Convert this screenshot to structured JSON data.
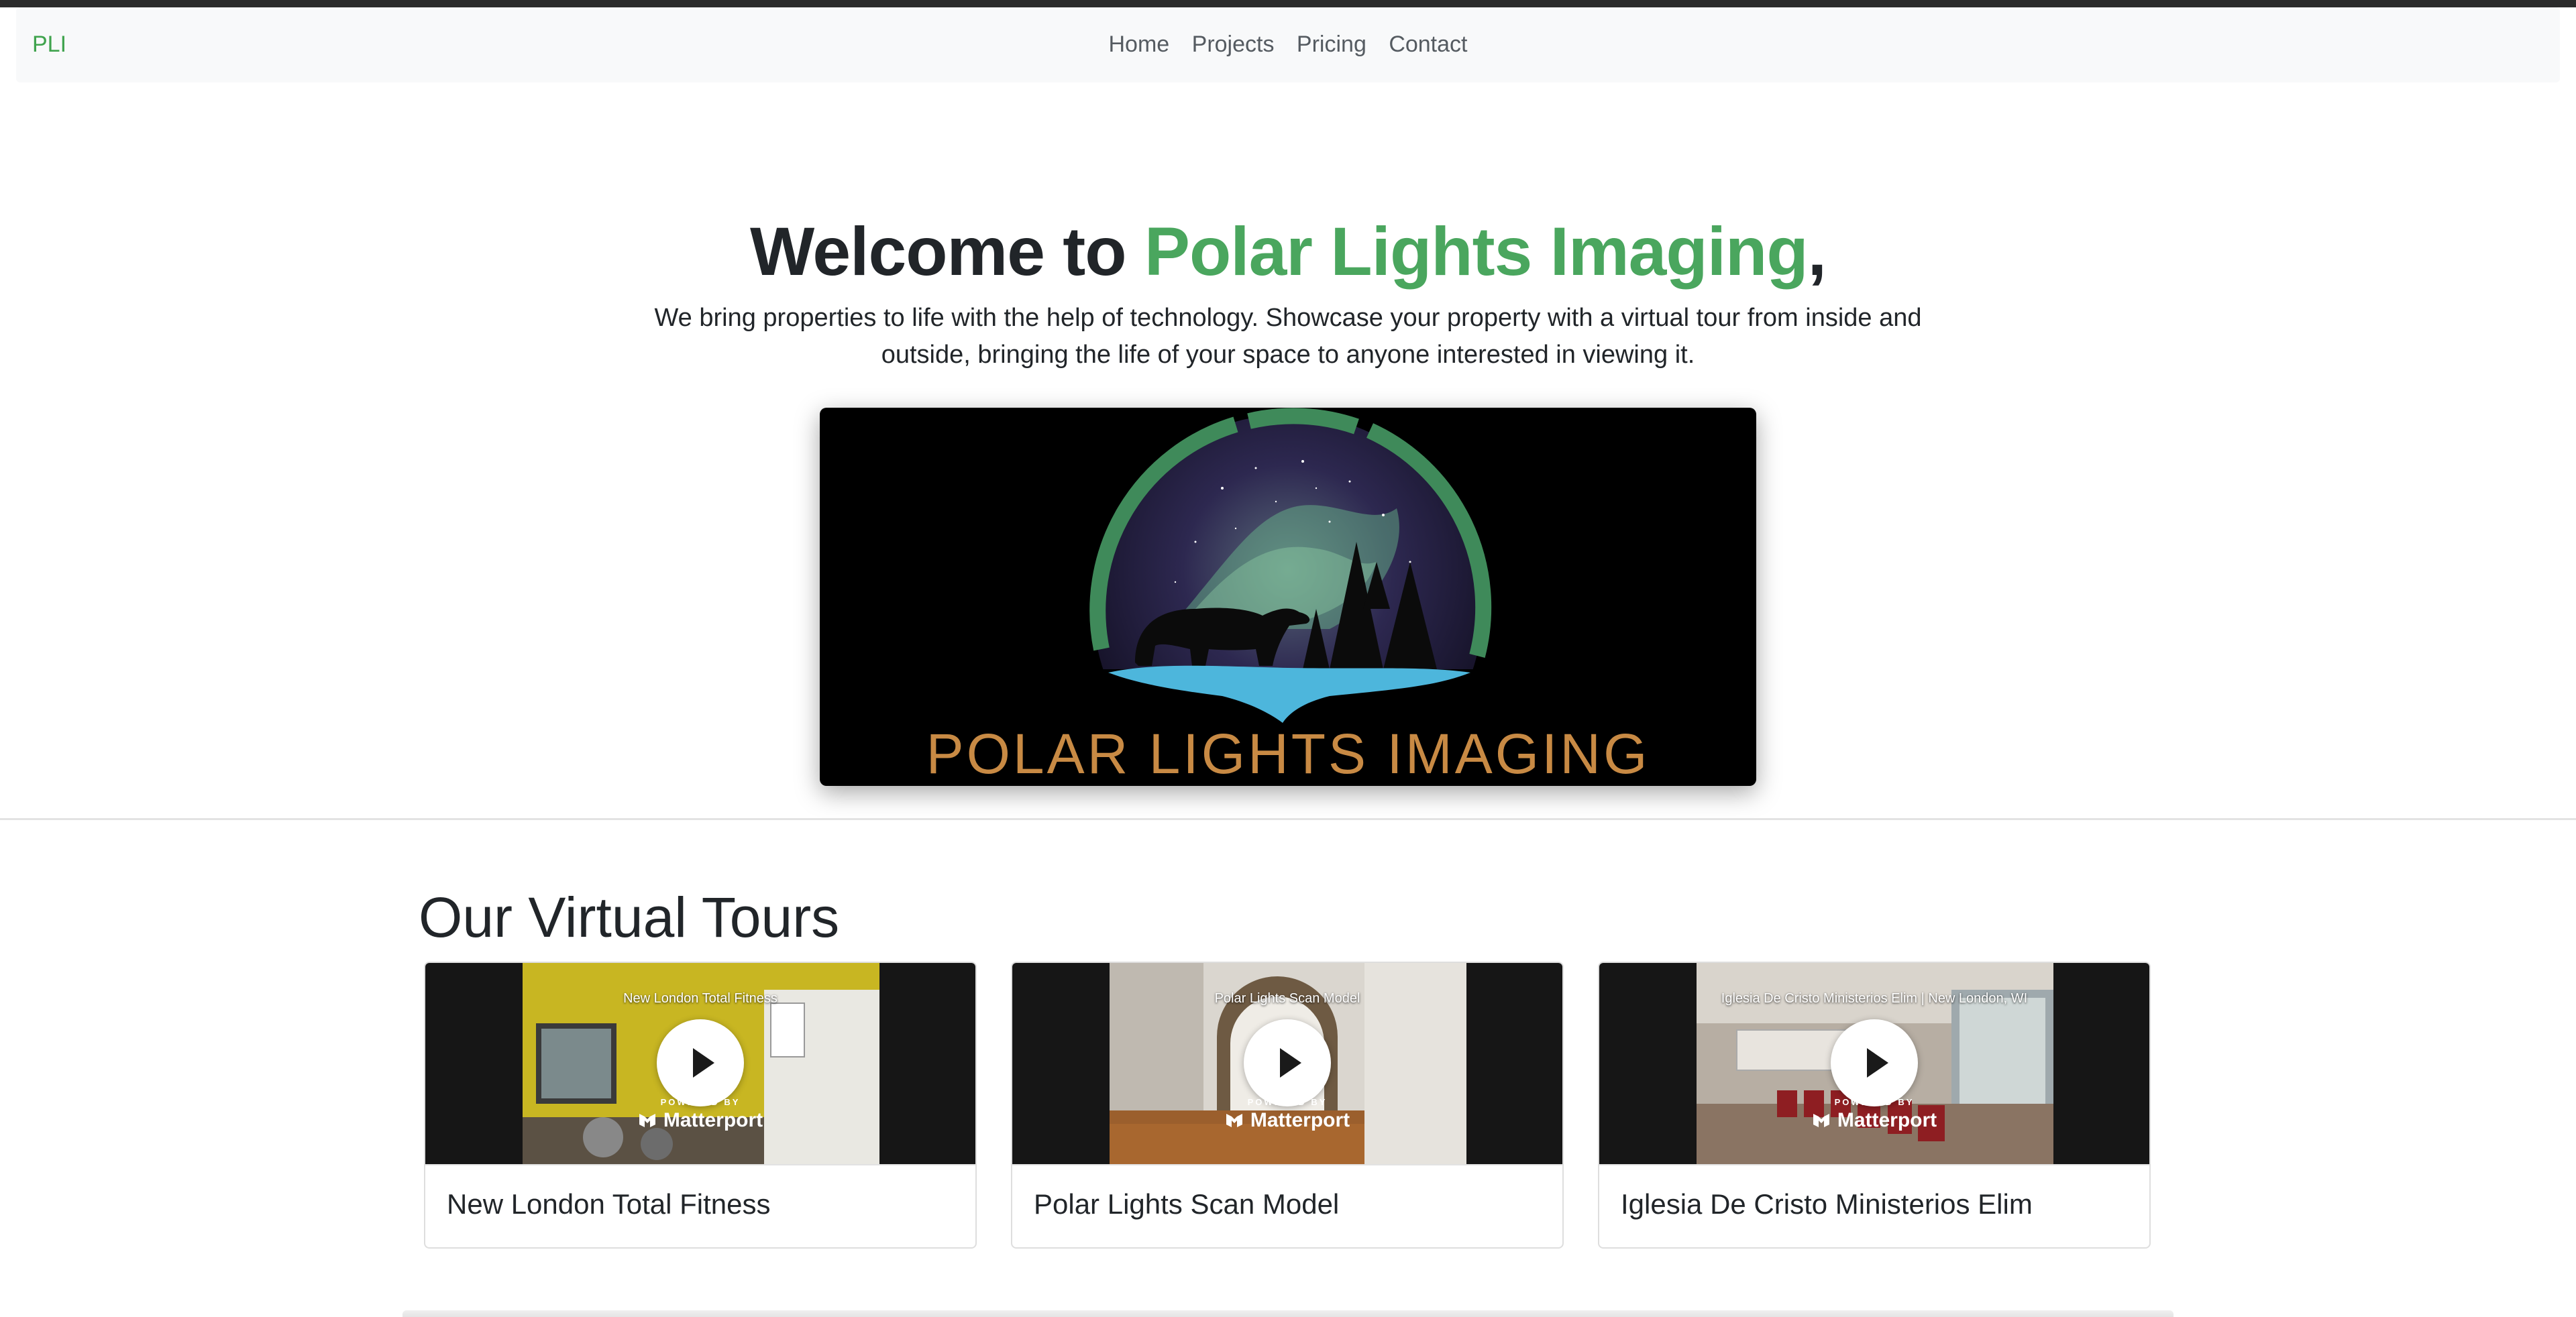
{
  "navbar": {
    "brand": "PLI",
    "links": [
      "Home",
      "Projects",
      "Pricing",
      "Contact"
    ]
  },
  "hero": {
    "title_prefix": "Welcome to ",
    "title_highlight": "Polar Lights Imaging",
    "title_suffix": ",",
    "description": "We bring properties to life with the help of technology. Showcase your property with a virtual tour from inside and outside, bringing the life of your space to anyone interested in viewing it.",
    "logo_text": "POLAR LIGHTS IMAGING"
  },
  "tours": {
    "heading": "Our Virtual Tours",
    "powered_by": "POWERED BY",
    "provider": "Matterport",
    "cards": [
      {
        "caption": "New London Total Fitness",
        "title": "New London Total Fitness"
      },
      {
        "caption": "Polar Lights Scan Model",
        "title": "Polar Lights Scan Model"
      },
      {
        "caption": "Iglesia De Cristo Ministerios Elim | New London, WI",
        "title": "Iglesia De Cristo Ministerios Elim"
      }
    ]
  },
  "colors": {
    "brand_green": "#4aa65e",
    "logo_orange": "#c88a44",
    "logo_water": "#4db6dc",
    "logo_ring": "#3f8a5a"
  }
}
